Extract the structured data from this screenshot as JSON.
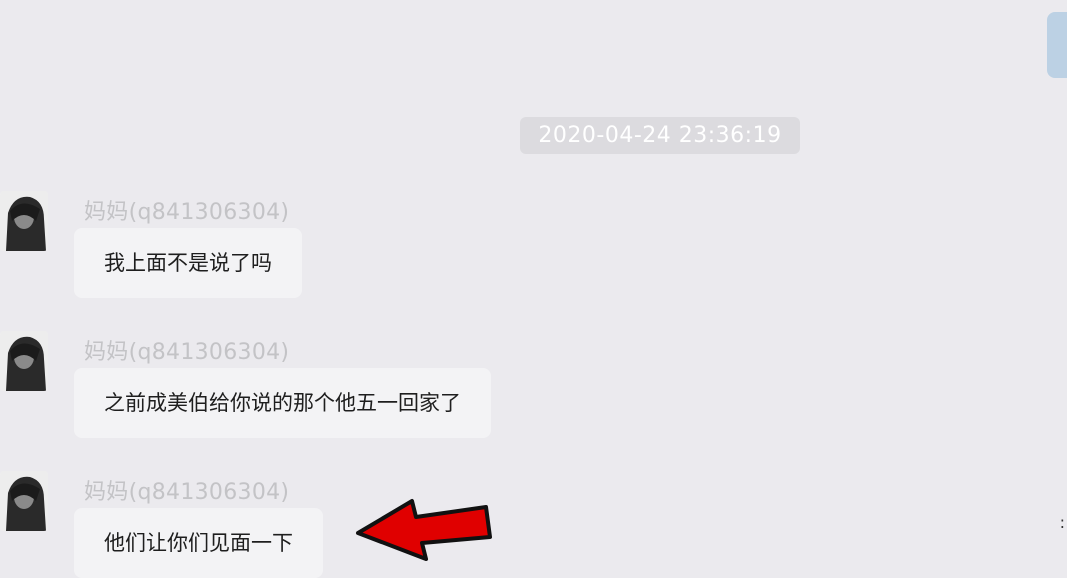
{
  "timestamp": "2020-04-24 23:36:19",
  "messages": [
    {
      "sender": "妈妈(q841306304)",
      "text": "我上面不是说了吗"
    },
    {
      "sender": "妈妈(q841306304)",
      "text": "之前成美伯给你说的那个他五一回家了"
    },
    {
      "sender": "妈妈(q841306304)",
      "text": "他们让你们见面一下"
    }
  ],
  "annotation": {
    "type": "red-arrow-icon",
    "color": "#e00000",
    "points_to": "他们让你们见面一下"
  },
  "colors": {
    "background": "#ebeaee",
    "bubble": "#f3f3f5",
    "timestamp_bg": "#dcdbdf",
    "sender_text": "#c3c3c6",
    "scrollbar": "#bcd1e4"
  }
}
